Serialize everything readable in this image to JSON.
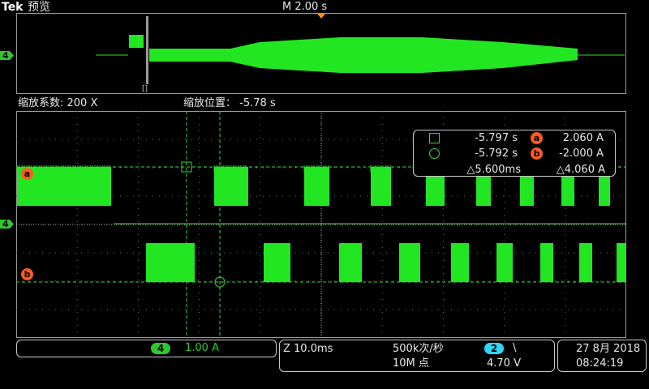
{
  "header": {
    "brand": "Tek",
    "mode": "预览",
    "timebase": "M 2.00 s"
  },
  "overview": {
    "channel": "4",
    "marker_glyph": "[]"
  },
  "zoom": {
    "factor_label": "缩放系数: 200 X",
    "position_label": "缩放位置： -5.78 s"
  },
  "cursor_readout": {
    "cursor1_time": "-5.797 s",
    "cursor2_time": "-5.792 s",
    "a_value": "2.060 A",
    "b_value": "-2.000 A",
    "delta_time": "△5.600ms",
    "delta_value": "△4.060 A",
    "a_label": "a",
    "b_label": "b"
  },
  "waveform": {
    "channel": "4",
    "trace_color": "#22e622",
    "grid_color": "#6e6e6e",
    "cursor_color": "#3ed43e",
    "marker_a": "a",
    "marker_b": "b"
  },
  "status": {
    "channel_number": "4",
    "channel_scale": "1.00 A",
    "zoom_scale": "Z 10.0ms",
    "sample_rate": "500k次/秒",
    "record_length": "10M 点",
    "trigger_channel": "2",
    "trigger_slope": "\\",
    "trigger_level": "4.70 V",
    "date": "27 8月 2018",
    "time": "08:24:19"
  }
}
